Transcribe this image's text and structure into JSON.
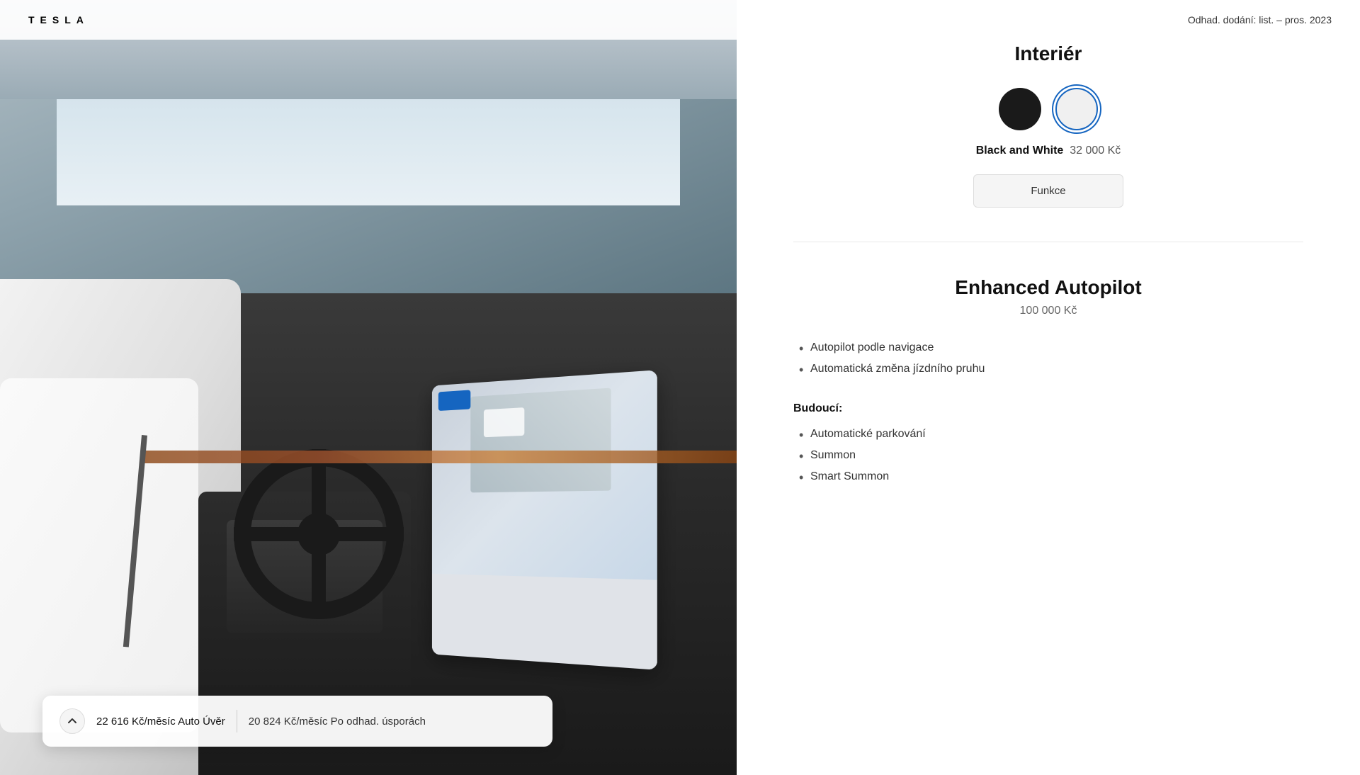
{
  "header": {
    "logo": "TESLA",
    "delivery_estimate": "Odhad. dodání: list. – pros. 2023"
  },
  "interior_section": {
    "title": "Interiér",
    "colors": [
      {
        "id": "black",
        "label": "Black",
        "selected": false
      },
      {
        "id": "white",
        "label": "White",
        "selected": true
      }
    ],
    "selected_color_label": "Black and White",
    "selected_color_price": "32 000 Kč",
    "funkce_button": "Funkce"
  },
  "autopilot_section": {
    "title": "Enhanced Autopilot",
    "price": "100 000 Kč",
    "features": [
      "Autopilot podle navigace",
      "Automatická změna jízdního pruhu"
    ],
    "future_label": "Budoucí:",
    "future_features": [
      "Automatické parkování",
      "Summon",
      "Smart Summon"
    ]
  },
  "bottom_bar": {
    "monthly_payment": "22 616 Kč/měsíc Auto Úvěr",
    "savings_payment": "20 824 Kč/měsíc Po odhad. úsporách"
  }
}
